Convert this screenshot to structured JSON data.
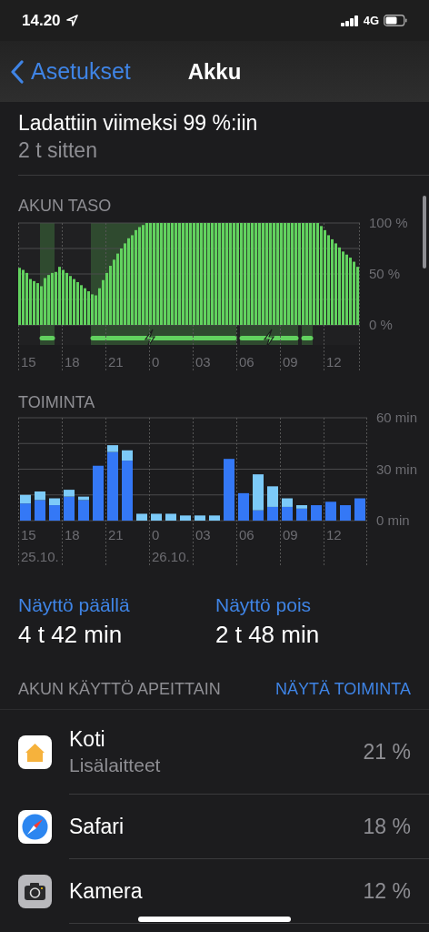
{
  "status_bar": {
    "time": "14.20",
    "network": "4G"
  },
  "nav": {
    "back": "Asetukset",
    "title": "Akku"
  },
  "last_charge": {
    "title": "Ladattiin viimeksi 99 %:iin",
    "subtitle": "2 t sitten"
  },
  "battery_level": {
    "heading": "AKUN TASO",
    "chart_data": {
      "type": "bar",
      "ylim": [
        0,
        100
      ],
      "values": [
        56,
        54,
        51,
        45,
        43,
        41,
        38,
        46,
        49,
        51,
        52,
        57,
        54,
        51,
        48,
        45,
        42,
        39,
        36,
        33,
        30,
        29,
        36,
        44,
        51,
        58,
        64,
        70,
        75,
        80,
        85,
        88,
        93,
        96,
        98,
        100,
        100,
        100,
        100,
        100,
        100,
        100,
        100,
        100,
        100,
        100,
        100,
        100,
        100,
        100,
        100,
        100,
        100,
        100,
        100,
        100,
        100,
        100,
        100,
        100,
        100,
        100,
        100,
        100,
        100,
        100,
        100,
        100,
        100,
        100,
        100,
        100,
        100,
        100,
        100,
        100,
        100,
        100,
        100,
        100,
        100,
        100,
        100,
        97,
        93,
        88,
        84,
        80,
        76,
        72,
        69,
        66,
        62,
        57
      ],
      "yticks": [
        {
          "value": 0,
          "label": "0 %"
        },
        {
          "value": 50,
          "label": "50 %"
        },
        {
          "value": 100,
          "label": "100 %"
        }
      ]
    },
    "charging": [
      false,
      false,
      false,
      false,
      false,
      false,
      true,
      true,
      true,
      true,
      false,
      false,
      false,
      false,
      false,
      false,
      false,
      false,
      false,
      false,
      true,
      true,
      true,
      true,
      true,
      true,
      true,
      true,
      true,
      true,
      true,
      true,
      true,
      true,
      true,
      true,
      true,
      true,
      true,
      true,
      true,
      true,
      true,
      true,
      true,
      true,
      true,
      true,
      true,
      true,
      true,
      true,
      true,
      true,
      true,
      true,
      true,
      true,
      true,
      true,
      false,
      true,
      true,
      true,
      true,
      true,
      true,
      true,
      true,
      true,
      true,
      true,
      true,
      true,
      true,
      true,
      true,
      false,
      true,
      true,
      true,
      false,
      false,
      false,
      false,
      false,
      false,
      false,
      false,
      false,
      false,
      false,
      false,
      false
    ],
    "hours": [
      {
        "label": "15"
      },
      {
        "label": "18"
      },
      {
        "label": "21"
      },
      {
        "label": "0"
      },
      {
        "label": "03"
      },
      {
        "label": "06"
      },
      {
        "label": "09"
      },
      {
        "label": "12"
      }
    ]
  },
  "activity": {
    "heading": "TOIMINTA",
    "chart_data": {
      "type": "bar",
      "stacked": true,
      "ylim": [
        0,
        60
      ],
      "series": [
        {
          "color": "#3478f6",
          "values": [
            10,
            12,
            9,
            14,
            12,
            32,
            40,
            35,
            0,
            0,
            0,
            0,
            0,
            0,
            36,
            16,
            6,
            8,
            8,
            7,
            9,
            11,
            9,
            13
          ]
        },
        {
          "color": "#7ccaf8",
          "values": [
            5,
            5,
            4,
            4,
            2,
            0,
            4,
            6,
            4,
            4,
            4,
            3,
            3,
            3,
            0,
            0,
            21,
            12,
            5,
            2,
            0,
            0,
            0,
            0
          ]
        }
      ],
      "yticks": [
        {
          "value": 0,
          "label": "0 min"
        },
        {
          "value": 30,
          "label": "30 min"
        },
        {
          "value": 60,
          "label": "60 min"
        }
      ]
    },
    "hours": [
      {
        "label": "15",
        "date": "25.10."
      },
      {
        "label": "18"
      },
      {
        "label": "21"
      },
      {
        "label": "0",
        "date": "26.10."
      },
      {
        "label": "03"
      },
      {
        "label": "06"
      },
      {
        "label": "09"
      },
      {
        "label": "12"
      }
    ]
  },
  "screen_time": [
    {
      "label": "Näyttö päällä",
      "value": "4 t 42 min"
    },
    {
      "label": "Näyttö pois",
      "value": "2 t 48 min"
    }
  ],
  "usage": {
    "heading": "AKUN KÄYTTÖ APEITTAIN",
    "action": "NÄYTÄ TOIMINTA",
    "apps": [
      {
        "kind": "home",
        "name": "Koti",
        "detail": "Lisälaitteet",
        "percent": "21 %"
      },
      {
        "kind": "safari",
        "name": "Safari",
        "percent": "18 %"
      },
      {
        "kind": "camera",
        "name": "Kamera",
        "percent": "12 %"
      }
    ]
  }
}
